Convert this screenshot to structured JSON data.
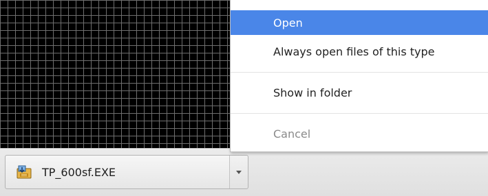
{
  "context_menu": {
    "items": [
      {
        "label": "Open",
        "state": "highlighted"
      },
      {
        "label": "Always open files of this type",
        "state": "normal"
      },
      {
        "label": "Show in folder",
        "state": "normal"
      },
      {
        "label": "Cancel",
        "state": "disabled"
      }
    ]
  },
  "download_shelf": {
    "item": {
      "file_name": "TP_600sf.EXE",
      "icon": "installer-icon"
    },
    "dropdown_icon": "chevron-down-icon"
  },
  "colors": {
    "highlight": "#4a86e8",
    "grid_background": "#000000",
    "grid_lines": "#6f6f6f",
    "disabled_text": "#8a8a8a"
  }
}
